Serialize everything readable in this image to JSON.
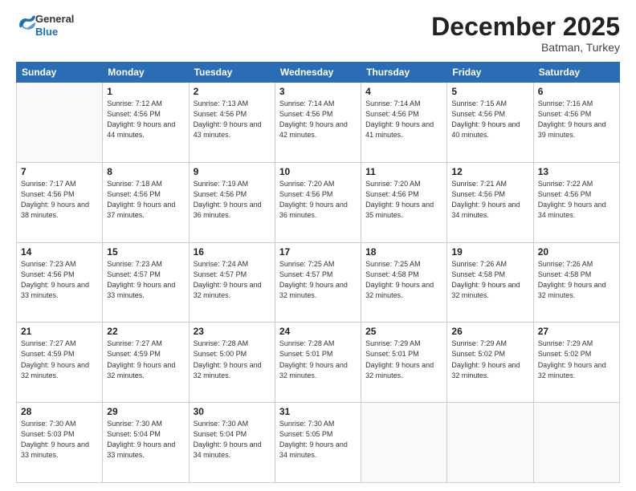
{
  "header": {
    "logo_general": "General",
    "logo_blue": "Blue",
    "month_title": "December 2025",
    "location": "Batman, Turkey"
  },
  "weekdays": [
    "Sunday",
    "Monday",
    "Tuesday",
    "Wednesday",
    "Thursday",
    "Friday",
    "Saturday"
  ],
  "weeks": [
    [
      {
        "day": "",
        "sunrise": "",
        "sunset": "",
        "daylight": ""
      },
      {
        "day": "1",
        "sunrise": "Sunrise: 7:12 AM",
        "sunset": "Sunset: 4:56 PM",
        "daylight": "Daylight: 9 hours and 44 minutes."
      },
      {
        "day": "2",
        "sunrise": "Sunrise: 7:13 AM",
        "sunset": "Sunset: 4:56 PM",
        "daylight": "Daylight: 9 hours and 43 minutes."
      },
      {
        "day": "3",
        "sunrise": "Sunrise: 7:14 AM",
        "sunset": "Sunset: 4:56 PM",
        "daylight": "Daylight: 9 hours and 42 minutes."
      },
      {
        "day": "4",
        "sunrise": "Sunrise: 7:14 AM",
        "sunset": "Sunset: 4:56 PM",
        "daylight": "Daylight: 9 hours and 41 minutes."
      },
      {
        "day": "5",
        "sunrise": "Sunrise: 7:15 AM",
        "sunset": "Sunset: 4:56 PM",
        "daylight": "Daylight: 9 hours and 40 minutes."
      },
      {
        "day": "6",
        "sunrise": "Sunrise: 7:16 AM",
        "sunset": "Sunset: 4:56 PM",
        "daylight": "Daylight: 9 hours and 39 minutes."
      }
    ],
    [
      {
        "day": "7",
        "sunrise": "Sunrise: 7:17 AM",
        "sunset": "Sunset: 4:56 PM",
        "daylight": "Daylight: 9 hours and 38 minutes."
      },
      {
        "day": "8",
        "sunrise": "Sunrise: 7:18 AM",
        "sunset": "Sunset: 4:56 PM",
        "daylight": "Daylight: 9 hours and 37 minutes."
      },
      {
        "day": "9",
        "sunrise": "Sunrise: 7:19 AM",
        "sunset": "Sunset: 4:56 PM",
        "daylight": "Daylight: 9 hours and 36 minutes."
      },
      {
        "day": "10",
        "sunrise": "Sunrise: 7:20 AM",
        "sunset": "Sunset: 4:56 PM",
        "daylight": "Daylight: 9 hours and 36 minutes."
      },
      {
        "day": "11",
        "sunrise": "Sunrise: 7:20 AM",
        "sunset": "Sunset: 4:56 PM",
        "daylight": "Daylight: 9 hours and 35 minutes."
      },
      {
        "day": "12",
        "sunrise": "Sunrise: 7:21 AM",
        "sunset": "Sunset: 4:56 PM",
        "daylight": "Daylight: 9 hours and 34 minutes."
      },
      {
        "day": "13",
        "sunrise": "Sunrise: 7:22 AM",
        "sunset": "Sunset: 4:56 PM",
        "daylight": "Daylight: 9 hours and 34 minutes."
      }
    ],
    [
      {
        "day": "14",
        "sunrise": "Sunrise: 7:23 AM",
        "sunset": "Sunset: 4:56 PM",
        "daylight": "Daylight: 9 hours and 33 minutes."
      },
      {
        "day": "15",
        "sunrise": "Sunrise: 7:23 AM",
        "sunset": "Sunset: 4:57 PM",
        "daylight": "Daylight: 9 hours and 33 minutes."
      },
      {
        "day": "16",
        "sunrise": "Sunrise: 7:24 AM",
        "sunset": "Sunset: 4:57 PM",
        "daylight": "Daylight: 9 hours and 32 minutes."
      },
      {
        "day": "17",
        "sunrise": "Sunrise: 7:25 AM",
        "sunset": "Sunset: 4:57 PM",
        "daylight": "Daylight: 9 hours and 32 minutes."
      },
      {
        "day": "18",
        "sunrise": "Sunrise: 7:25 AM",
        "sunset": "Sunset: 4:58 PM",
        "daylight": "Daylight: 9 hours and 32 minutes."
      },
      {
        "day": "19",
        "sunrise": "Sunrise: 7:26 AM",
        "sunset": "Sunset: 4:58 PM",
        "daylight": "Daylight: 9 hours and 32 minutes."
      },
      {
        "day": "20",
        "sunrise": "Sunrise: 7:26 AM",
        "sunset": "Sunset: 4:58 PM",
        "daylight": "Daylight: 9 hours and 32 minutes."
      }
    ],
    [
      {
        "day": "21",
        "sunrise": "Sunrise: 7:27 AM",
        "sunset": "Sunset: 4:59 PM",
        "daylight": "Daylight: 9 hours and 32 minutes."
      },
      {
        "day": "22",
        "sunrise": "Sunrise: 7:27 AM",
        "sunset": "Sunset: 4:59 PM",
        "daylight": "Daylight: 9 hours and 32 minutes."
      },
      {
        "day": "23",
        "sunrise": "Sunrise: 7:28 AM",
        "sunset": "Sunset: 5:00 PM",
        "daylight": "Daylight: 9 hours and 32 minutes."
      },
      {
        "day": "24",
        "sunrise": "Sunrise: 7:28 AM",
        "sunset": "Sunset: 5:01 PM",
        "daylight": "Daylight: 9 hours and 32 minutes."
      },
      {
        "day": "25",
        "sunrise": "Sunrise: 7:29 AM",
        "sunset": "Sunset: 5:01 PM",
        "daylight": "Daylight: 9 hours and 32 minutes."
      },
      {
        "day": "26",
        "sunrise": "Sunrise: 7:29 AM",
        "sunset": "Sunset: 5:02 PM",
        "daylight": "Daylight: 9 hours and 32 minutes."
      },
      {
        "day": "27",
        "sunrise": "Sunrise: 7:29 AM",
        "sunset": "Sunset: 5:02 PM",
        "daylight": "Daylight: 9 hours and 32 minutes."
      }
    ],
    [
      {
        "day": "28",
        "sunrise": "Sunrise: 7:30 AM",
        "sunset": "Sunset: 5:03 PM",
        "daylight": "Daylight: 9 hours and 33 minutes."
      },
      {
        "day": "29",
        "sunrise": "Sunrise: 7:30 AM",
        "sunset": "Sunset: 5:04 PM",
        "daylight": "Daylight: 9 hours and 33 minutes."
      },
      {
        "day": "30",
        "sunrise": "Sunrise: 7:30 AM",
        "sunset": "Sunset: 5:04 PM",
        "daylight": "Daylight: 9 hours and 34 minutes."
      },
      {
        "day": "31",
        "sunrise": "Sunrise: 7:30 AM",
        "sunset": "Sunset: 5:05 PM",
        "daylight": "Daylight: 9 hours and 34 minutes."
      },
      {
        "day": "",
        "sunrise": "",
        "sunset": "",
        "daylight": ""
      },
      {
        "day": "",
        "sunrise": "",
        "sunset": "",
        "daylight": ""
      },
      {
        "day": "",
        "sunrise": "",
        "sunset": "",
        "daylight": ""
      }
    ]
  ]
}
